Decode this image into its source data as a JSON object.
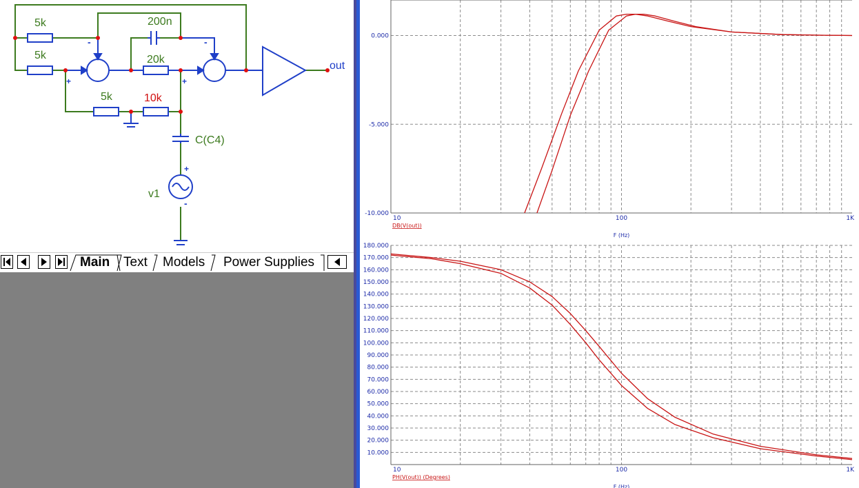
{
  "schematic": {
    "labels": {
      "r1": "5k",
      "r2": "5k",
      "r3": "5k",
      "r4": "10k",
      "r5": "20k",
      "c1": "200n",
      "c4": "C(C4)",
      "v1": "v1",
      "out": "out"
    },
    "signs": {
      "minus": "-",
      "plus": "+"
    }
  },
  "tabs": [
    {
      "label": "Main",
      "active": true
    },
    {
      "label": "Text",
      "active": false
    },
    {
      "label": "Models",
      "active": false
    },
    {
      "label": "Power Supplies",
      "active": false
    }
  ],
  "colors": {
    "wire": "#3c7a1e",
    "component": "#1f3fc8",
    "node": "#e01010",
    "trace": "#c81414",
    "axis_text": "#1c2aa8",
    "grid": "#8a8a8a",
    "red_label": "#d01010"
  },
  "chart_data": [
    {
      "type": "line",
      "x_scale": "log",
      "xlim": [
        10,
        1000
      ],
      "ylim": [
        -10,
        2
      ],
      "x_ticks": [
        "10",
        "100",
        "1K"
      ],
      "y_ticks": [
        "-10.000",
        "-5.000",
        "0.000"
      ],
      "xlabel": "F (Hz)",
      "trace_label": "DB(V(out))",
      "grid": true,
      "series": [
        {
          "x": [
            38,
            45,
            55,
            65,
            80,
            95,
            105,
            115,
            130,
            160,
            200,
            300,
            500,
            700,
            1000
          ],
          "y": [
            -10,
            -7.5,
            -4.4,
            -2.0,
            0.3,
            1.1,
            1.2,
            1.2,
            1.1,
            0.8,
            0.5,
            0.2,
            0.05,
            0.02,
            0.0
          ]
        },
        {
          "x": [
            43,
            50,
            60,
            72,
            88,
            105,
            115,
            125,
            140,
            170,
            210,
            300,
            500,
            700,
            1000
          ],
          "y": [
            -10,
            -7.6,
            -4.5,
            -2.0,
            0.3,
            1.1,
            1.2,
            1.2,
            1.1,
            0.8,
            0.5,
            0.2,
            0.05,
            0.02,
            0.0
          ]
        }
      ]
    },
    {
      "type": "line",
      "x_scale": "log",
      "xlim": [
        10,
        1000
      ],
      "ylim": [
        0,
        180
      ],
      "x_ticks": [
        "10",
        "100",
        "1K"
      ],
      "y_ticks": [
        "10.000",
        "20.000",
        "30.000",
        "40.000",
        "50.000",
        "60.000",
        "70.000",
        "80.000",
        "90.000",
        "100.000",
        "110.000",
        "120.000",
        "130.000",
        "140.000",
        "150.000",
        "160.000",
        "170.000",
        "180.000"
      ],
      "xlabel": "F (Hz)",
      "trace_label": "PH(V(out)) (Degrees)",
      "grid": true,
      "series": [
        {
          "x": [
            10,
            15,
            20,
            30,
            40,
            50,
            60,
            70,
            80,
            100,
            130,
            170,
            250,
            400,
            700,
            1000
          ],
          "y": [
            172,
            169,
            165,
            157,
            145,
            131,
            115,
            100,
            86,
            65,
            46,
            33,
            22,
            13,
            7,
            4
          ]
        },
        {
          "x": [
            10,
            15,
            20,
            30,
            40,
            50,
            60,
            70,
            80,
            100,
            130,
            170,
            250,
            400,
            700,
            1000
          ],
          "y": [
            173,
            170,
            167,
            160,
            150,
            138,
            124,
            110,
            97,
            75,
            54,
            39,
            25,
            15,
            8,
            5
          ]
        }
      ]
    }
  ]
}
